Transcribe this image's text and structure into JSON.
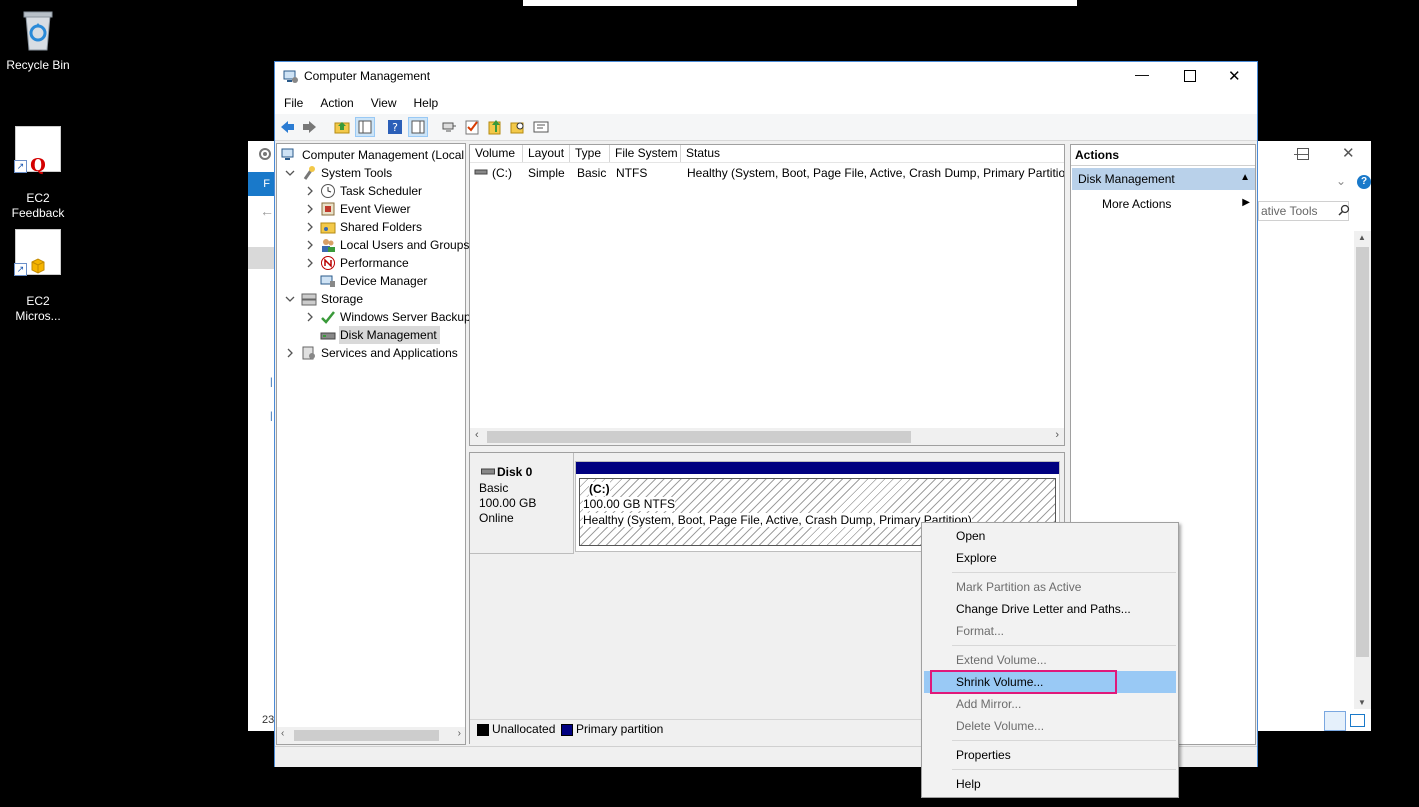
{
  "desktop": {
    "icons": [
      {
        "label": "Recycle Bin"
      },
      {
        "label": "EC2\nFeedback"
      },
      {
        "label": "EC2\nMicros..."
      }
    ]
  },
  "bg_window": {
    "search_placeholder": "ative Tools",
    "left_tab": "F",
    "side_number": "23"
  },
  "window": {
    "title": "Computer Management",
    "menu": [
      "File",
      "Action",
      "View",
      "Help"
    ],
    "tree": {
      "root": "Computer Management (Local",
      "system_tools": "System Tools",
      "task_scheduler": "Task Scheduler",
      "event_viewer": "Event Viewer",
      "shared_folders": "Shared Folders",
      "local_users": "Local Users and Groups",
      "performance": "Performance",
      "device_manager": "Device Manager",
      "storage": "Storage",
      "ws_backup": "Windows Server Backup",
      "disk_management": "Disk Management",
      "services": "Services and Applications"
    },
    "volume_table": {
      "headers": [
        "Volume",
        "Layout",
        "Type",
        "File System",
        "Status"
      ],
      "rows": [
        {
          "volume": "(C:)",
          "layout": "Simple",
          "type": "Basic",
          "fs": "NTFS",
          "status": "Healthy (System, Boot, Page File, Active, Crash Dump, Primary Partition"
        }
      ]
    },
    "disk": {
      "name": "Disk 0",
      "kind": "Basic",
      "size": "100.00 GB",
      "state": "Online",
      "partition_label": "(C:)",
      "partition_size": "100.00 GB NTFS",
      "partition_status": "Healthy (System, Boot, Page File, Active, Crash Dump, Primary Partition)"
    },
    "legend": {
      "unallocated": "Unallocated",
      "primary": "Primary partition"
    },
    "actions": {
      "header": "Actions",
      "section": "Disk Management",
      "more": "More Actions"
    }
  },
  "context_menu": {
    "open": "Open",
    "explore": "Explore",
    "mark_active": "Mark Partition as Active",
    "change_letter": "Change Drive Letter and Paths...",
    "format": "Format...",
    "extend": "Extend Volume...",
    "shrink": "Shrink Volume...",
    "add_mirror": "Add Mirror...",
    "delete": "Delete Volume...",
    "properties": "Properties",
    "help": "Help"
  },
  "colors": {
    "primary_partition": "#000080",
    "selection": "#99c9f5",
    "highlight_box": "#e0197a",
    "actions_section": "#b9d1ea"
  }
}
